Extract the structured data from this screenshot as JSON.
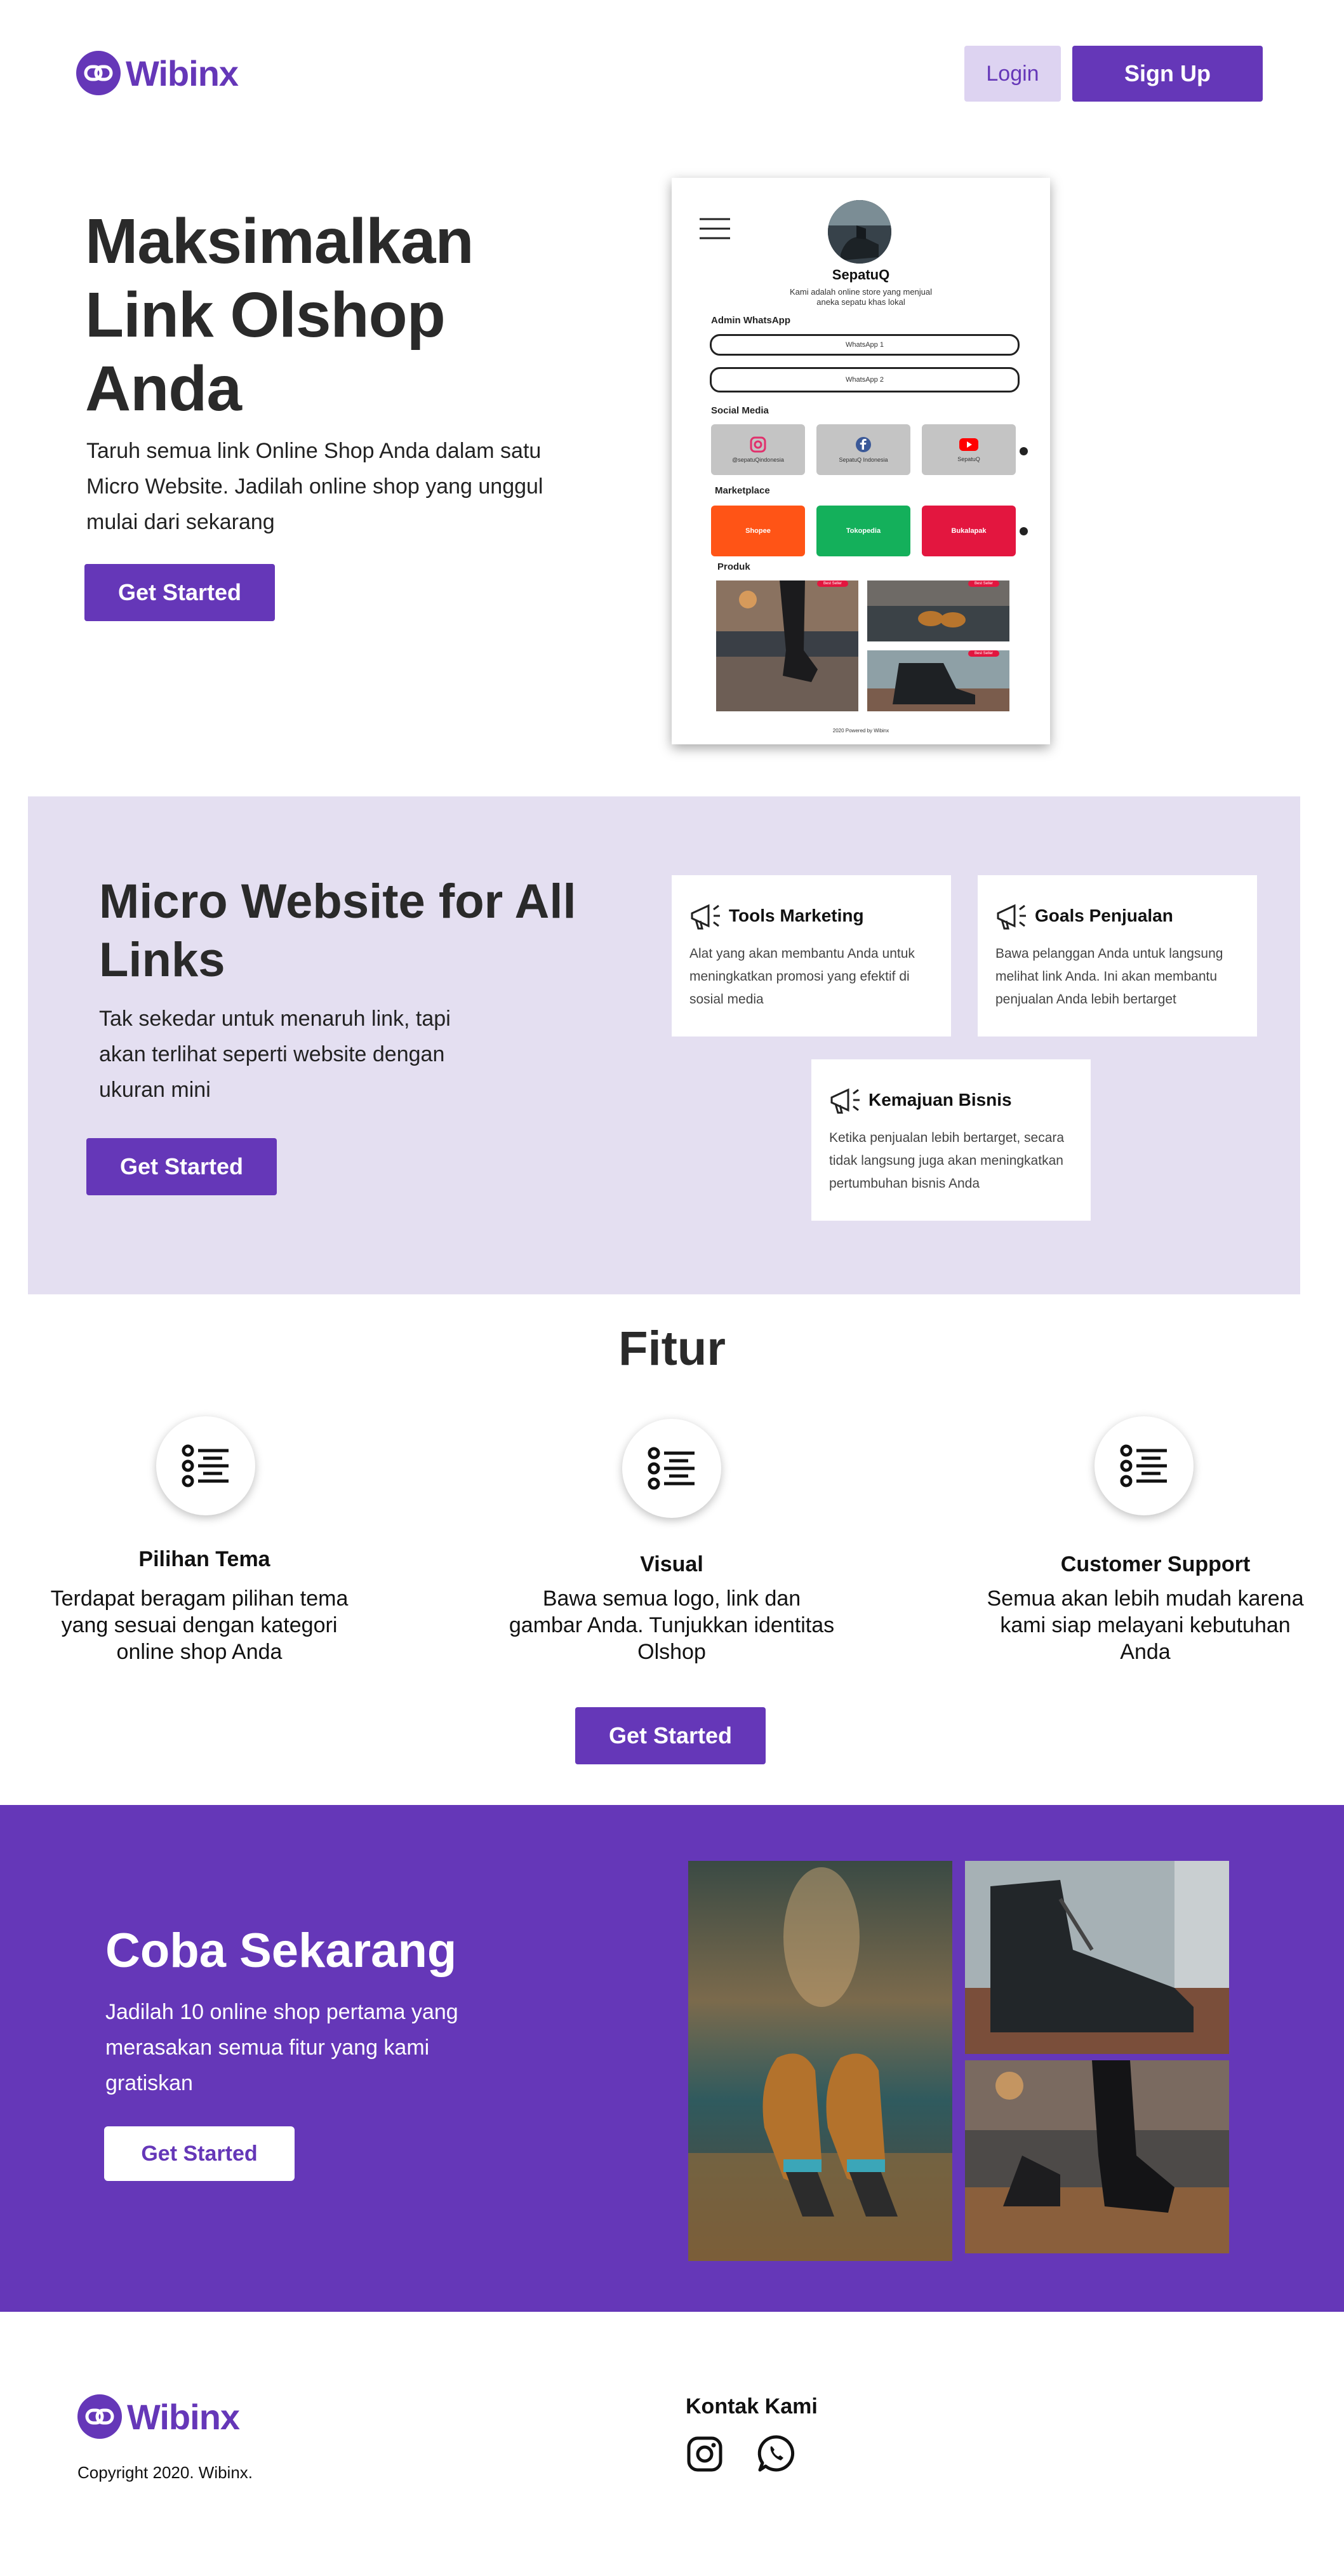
{
  "header": {
    "logo_text": "Wibinx",
    "login_label": "Login",
    "signup_label": "Sign Up"
  },
  "hero": {
    "title_lines": [
      "Maksimalkan",
      "Link Olshop",
      "Anda"
    ],
    "subtitle": "Taruh semua link Online Shop Anda dalam satu Micro Website. Jadilah online shop yang unggul mulai dari sekarang",
    "cta_label": "Get Started"
  },
  "mockup": {
    "store_name": "SepatuQ",
    "store_desc": "Kami adalah online store yang menjual aneka sepatu khas lokal",
    "admin_title": "Admin WhatsApp",
    "whatsapp_buttons": [
      "WhatsApp 1",
      "WhatsApp 2"
    ],
    "social_title": "Social Media",
    "social": [
      {
        "label": "@sepatuQindonesia",
        "icon": "instagram-icon"
      },
      {
        "label": "SepatuQ Indonesia",
        "icon": "facebook-icon"
      },
      {
        "label": "SepatuQ",
        "icon": "youtube-icon"
      }
    ],
    "marketplace_title": "Marketplace",
    "marketplace": [
      {
        "label": "Shopee",
        "color": "#ff5416"
      },
      {
        "label": "Tokopedia",
        "color": "#14b05b"
      },
      {
        "label": "Bukalapak",
        "color": "#e3163f"
      }
    ],
    "produk_title": "Produk",
    "badge_label": "Best Seller",
    "footer_text": "2020 Powered by Wibinx"
  },
  "micro": {
    "title": "Micro Website for All Links",
    "subtitle": "Tak sekedar untuk menaruh link, tapi akan terlihat seperti website dengan ukuran mini",
    "cta_label": "Get Started",
    "cards": [
      {
        "title": "Tools Marketing",
        "desc": "Alat yang akan membantu Anda untuk meningkatkan promosi yang efektif di sosial media",
        "icon": "megaphone-icon"
      },
      {
        "title": "Goals Penjualan",
        "desc": "Bawa pelanggan Anda untuk langsung melihat link Anda. Ini akan membantu penjualan Anda lebih bertarget",
        "icon": "megaphone-icon"
      },
      {
        "title": "Kemajuan Bisnis",
        "desc": "Ketika penjualan lebih bertarget, secara tidak langsung juga akan meningkatkan pertumbuhan bisnis Anda",
        "icon": "megaphone-icon"
      }
    ]
  },
  "fitur": {
    "title": "Fitur",
    "items": [
      {
        "title": "Pilihan Tema",
        "desc": "Terdapat beragam pilihan tema yang sesuai dengan kategori online shop Anda",
        "icon": "list-icon"
      },
      {
        "title": "Visual",
        "desc": "Bawa semua logo, link dan gambar Anda. Tunjukkan identitas Olshop",
        "icon": "list-icon"
      },
      {
        "title": "Customer Support",
        "desc": "Semua akan lebih mudah karena kami siap melayani kebutuhan Anda",
        "icon": "list-icon"
      }
    ],
    "cta_label": "Get Started"
  },
  "coba": {
    "title": "Coba Sekarang",
    "subtitle": "Jadilah 10 online shop pertama yang merasakan semua fitur yang kami gratiskan",
    "cta_label": "Get Started"
  },
  "footer": {
    "logo_text": "Wibinx",
    "copyright": "Copyright 2020. Wibinx.",
    "contact_title": "Kontak Kami",
    "icons": [
      "instagram-icon",
      "whatsapp-icon"
    ]
  },
  "colors": {
    "brand": "#6537b8",
    "brand_light": "#ddd3f1",
    "section_bg": "#e4dff1"
  }
}
